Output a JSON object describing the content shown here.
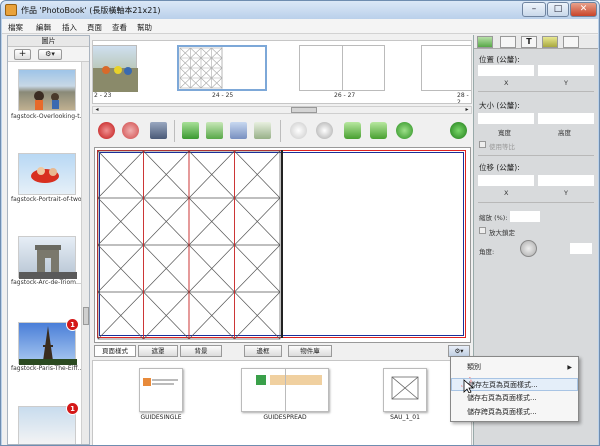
{
  "window": {
    "title": "作品 'PhotoBook' (長版橫軸本21x21)",
    "min_glyph": "–",
    "max_glyph": "□",
    "close_glyph": "✕"
  },
  "menu": [
    "檔案",
    "編輯",
    "插入",
    "頁面",
    "查看",
    "幫助"
  ],
  "photos_panel": {
    "title": "圖片",
    "add_label": "+",
    "options_label": "⚙▾",
    "photos": [
      {
        "caption": "fagstock-Overlooking-t…"
      },
      {
        "caption": "fagstock-Portrait-of-two…"
      },
      {
        "caption": "fagstock-Arc-de-Triom…"
      },
      {
        "caption": "fagstock-Paris-The-Eiff…",
        "badge": "1"
      },
      {
        "caption": "",
        "badge": "1"
      }
    ]
  },
  "spreads": [
    {
      "label": "2 - 23"
    },
    {
      "label": "24 - 25"
    },
    {
      "label": "26 - 27"
    },
    {
      "label": "28 - 2"
    }
  ],
  "bottom_tabs": [
    "頁面樣式",
    "遮罩",
    "背景",
    "邊框",
    "物件庫"
  ],
  "bottom_tabs_options": "⚙▾",
  "templates": [
    {
      "label": "GUIDESINGLE"
    },
    {
      "label": "GUIDESPREAD"
    },
    {
      "label": "SAU_1_01"
    }
  ],
  "properties": {
    "position_title": "位置 (公釐):",
    "x_label": "X",
    "y_label": "Y",
    "size_title": "大小 (公釐):",
    "width_label": "寬度",
    "height_label": "高度",
    "keep_ratio": "使用等比",
    "offset_title": "位移 (公釐):",
    "scale_label": "縮放 (%):",
    "zoom_locked": "放大鎖定",
    "angle_label": "角度:"
  },
  "context_menu": {
    "items": [
      {
        "label": "類別",
        "arrow": "▶"
      },
      {
        "label": "儲存左頁為頁面樣式..."
      },
      {
        "label": "儲存右頁為頁面樣式..."
      },
      {
        "label": "儲存跨頁為頁面樣式..."
      }
    ]
  }
}
